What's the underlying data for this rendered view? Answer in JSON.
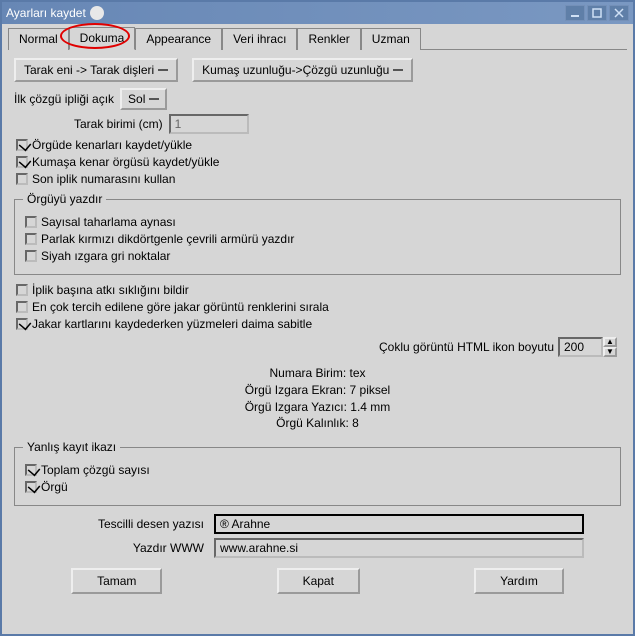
{
  "window": {
    "title": "Ayarları kaydet"
  },
  "tabs": [
    "Normal",
    "Dokuma",
    "Appearance",
    "Veri ihracı",
    "Renkler",
    "Uzman"
  ],
  "activeTab": 1,
  "buttons": {
    "tarak": "Tarak eni -> Tarak dişleri",
    "kumas": "Kumaş uzunluğu->Çözgü uzunluğu"
  },
  "ilk_cozgu": {
    "label": "İlk çözgü ipliği açık",
    "value": "Sol"
  },
  "tarak_birimi": {
    "label": "Tarak birimi (cm)",
    "value": "1"
  },
  "checks": {
    "c1": {
      "label": "Örgüde kenarları kaydet/yükle",
      "checked": true
    },
    "c2": {
      "label": "Kumaşa kenar örgüsü kaydet/yükle",
      "checked": true
    },
    "c3": {
      "label": "Son iplik numarasını kullan",
      "checked": false
    }
  },
  "group_orgu": {
    "legend": "Örgüyü yazdır",
    "o1": {
      "label": "Sayısal taharlama aynası",
      "checked": false
    },
    "o2": {
      "label": "Parlak kırmızı dikdörtgenle çevrili armürü yazdır",
      "checked": false
    },
    "o3": {
      "label": "Siyah ızgara gri noktalar",
      "checked": false
    }
  },
  "checks2": {
    "d1": {
      "label": "İplik başına atkı sıklığını bildir",
      "checked": false
    },
    "d2": {
      "label": "En çok tercih edilene göre jakar görüntü renklerini sırala",
      "checked": false
    },
    "d3": {
      "label": "Jakar kartlarını kaydederken yüzmeleri daima sabitle",
      "checked": true
    }
  },
  "spin": {
    "label": "Çoklu görüntü HTML ikon boyutu",
    "value": "200"
  },
  "info": {
    "l1": "Numara Birim: tex",
    "l2": "Örgü Izgara Ekran: 7 piksel",
    "l3": "Örgü Izgara Yazıcı: 1.4 mm",
    "l4": "Örgü Kalınlık: 8"
  },
  "group_yanlis": {
    "legend": "Yanlış kayıt ikazı",
    "y1": {
      "label": "Toplam çözgü sayısı",
      "checked": true
    },
    "y2": {
      "label": "Örgü",
      "checked": true
    }
  },
  "fields": {
    "tescilli": {
      "label": "Tescilli desen yazısı",
      "value": "® Arahne"
    },
    "www": {
      "label": "Yazdır WWW",
      "value": "www.arahne.si"
    }
  },
  "bottom": {
    "ok": "Tamam",
    "close": "Kapat",
    "help": "Yardım"
  }
}
